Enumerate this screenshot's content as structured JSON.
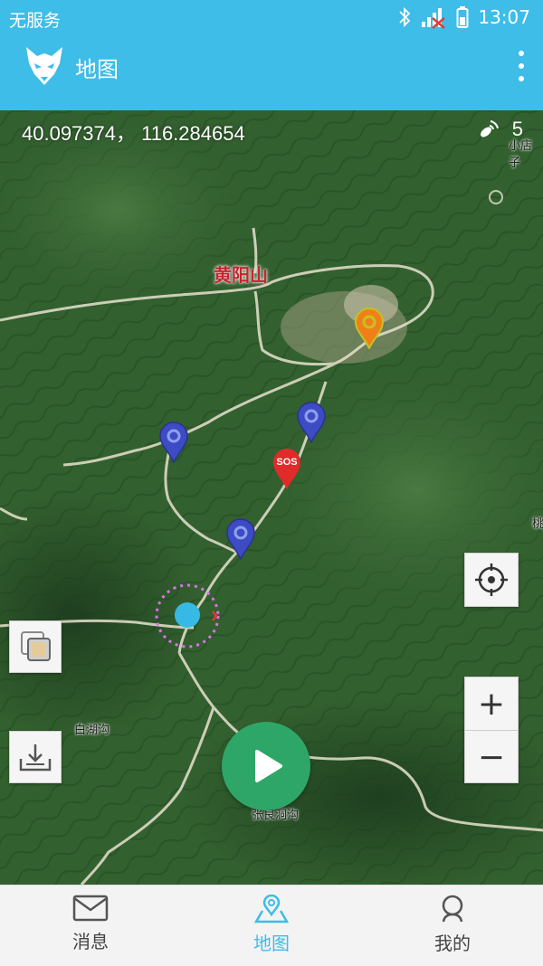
{
  "status_bar": {
    "carrier": "无服务",
    "time": "13:07"
  },
  "app_bar": {
    "title": "地图",
    "logo": "wolf-logo-icon",
    "menu_icon": "more-vertical-icon"
  },
  "map": {
    "coordinates": "40.097374， 116.284654",
    "satellite_count": "5",
    "labels": {
      "mountain": "黄阳山",
      "village_nw": "小店子",
      "village_sw": "白湖沟",
      "village_s": "张良洞沟",
      "edge": "桃"
    },
    "markers": [
      {
        "type": "orange",
        "icon": "location-pin-icon"
      },
      {
        "type": "blue",
        "icon": "location-pin-icon"
      },
      {
        "type": "blue",
        "icon": "location-pin-icon"
      },
      {
        "type": "blue",
        "icon": "location-pin-icon"
      },
      {
        "type": "sos",
        "label": "SOS"
      }
    ]
  },
  "controls": {
    "zoom_in": "+",
    "zoom_out": "−"
  },
  "tabs": [
    {
      "label": "消息",
      "icon": "mail-icon",
      "active": false
    },
    {
      "label": "地图",
      "icon": "map-pin-icon",
      "active": true
    },
    {
      "label": "我的",
      "icon": "user-icon",
      "active": false
    }
  ],
  "colors": {
    "primary": "#3dbde8",
    "play": "#2ea667",
    "sos": "#e02b2b"
  }
}
